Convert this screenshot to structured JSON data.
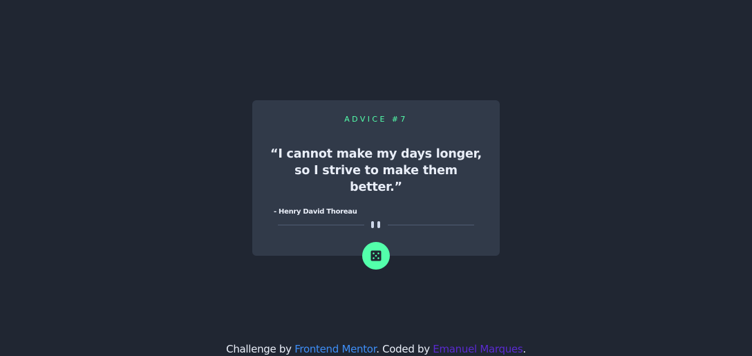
{
  "card": {
    "advice_label": "ADVICE #7",
    "quote": "“I cannot make my days longer, so I strive to make them better.”",
    "author": "- Henry David Thoreau"
  },
  "dice_button": {
    "icon": "dice-icon"
  },
  "footer": {
    "prefix": "Challenge by ",
    "link1": "Frontend Mentor",
    "middle": ". Coded by ",
    "link2": "Emanuel Marques",
    "suffix": "."
  },
  "colors": {
    "background": "#202632",
    "card": "#313a49",
    "accent": "#53ffab",
    "link1": "#3e8ef7",
    "link2": "#5a2ad1"
  }
}
